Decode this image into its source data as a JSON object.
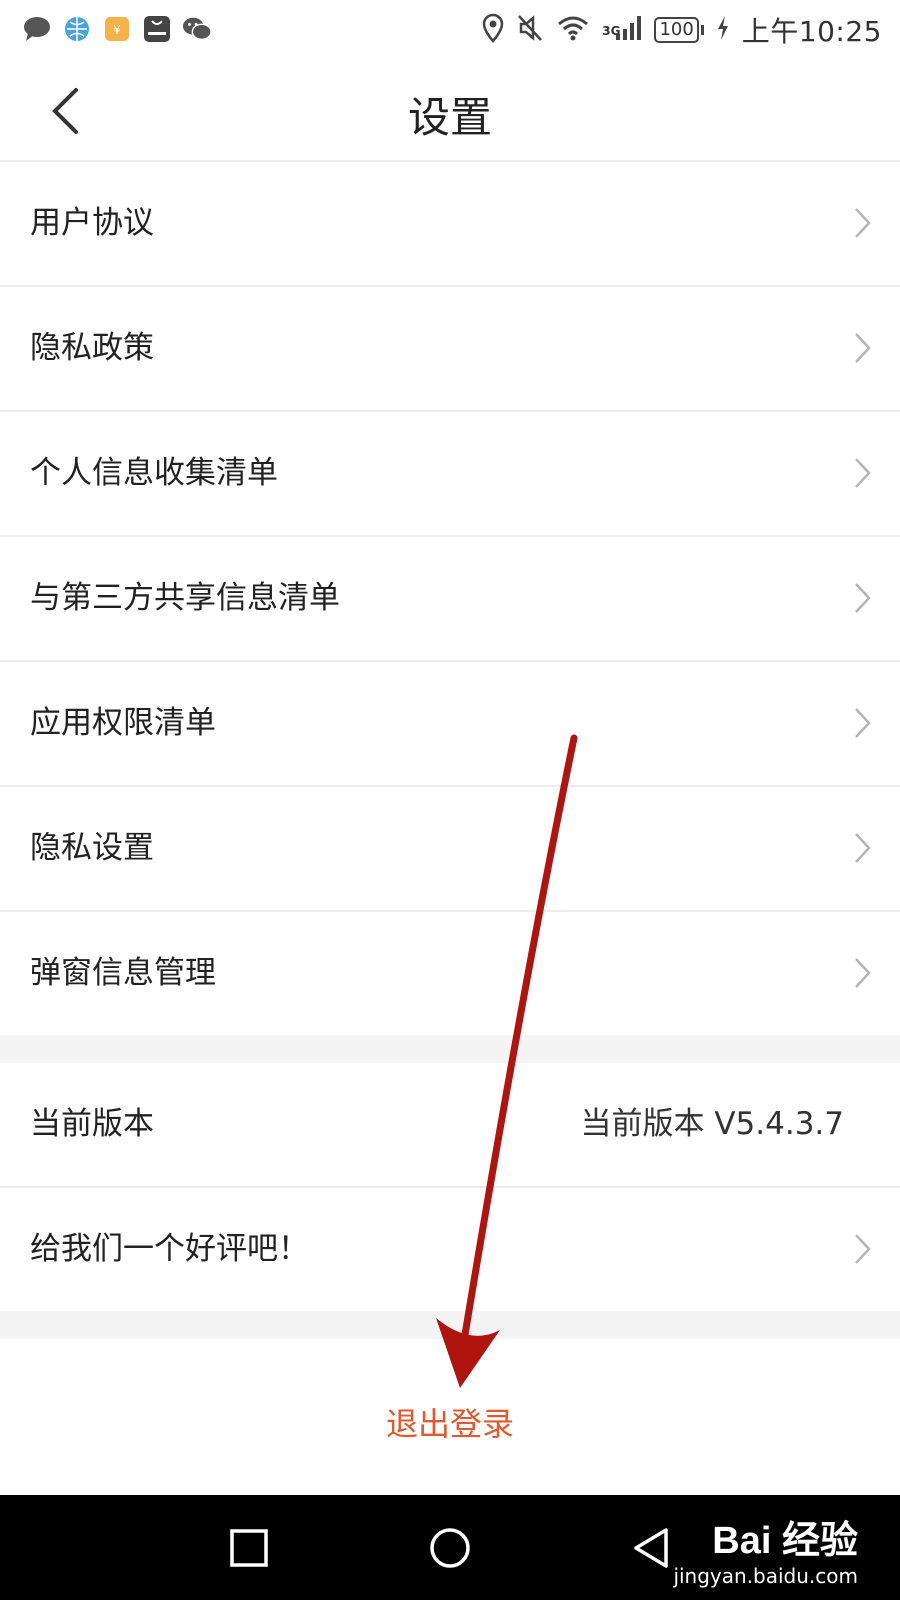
{
  "status_bar": {
    "time": "上午10:25",
    "battery": "100",
    "network": "3G",
    "left_icons": [
      "message-icon",
      "browser-icon",
      "wallet-icon",
      "huawei-icon",
      "wechat-icon"
    ],
    "right_icons": [
      "location-icon",
      "mute-icon",
      "wifi-icon",
      "signal-icon",
      "battery-icon",
      "charging-icon"
    ]
  },
  "header": {
    "title": "设置",
    "back_icon": "chevron-left-icon"
  },
  "settings": {
    "items": [
      {
        "label": "用户协议"
      },
      {
        "label": "隐私政策"
      },
      {
        "label": "个人信息收集清单"
      },
      {
        "label": "与第三方共享信息清单"
      },
      {
        "label": "应用权限清单"
      },
      {
        "label": "隐私设置"
      },
      {
        "label": "弹窗信息管理"
      }
    ],
    "version_label": "当前版本",
    "version_value": "当前版本 V5.4.3.7",
    "rate_label": "给我们一个好评吧！",
    "logout_label": "退出登录"
  },
  "nav_bar": {
    "icons": [
      "square-icon",
      "circle-icon",
      "triangle-back-icon"
    ]
  },
  "watermark": {
    "main": "Bai 经验",
    "sub": "jingyan.baidu.com"
  },
  "colors": {
    "logout": "#e05a2f",
    "annotation_arrow": "#b0140f",
    "divider": "#ededed",
    "gap": "#f4f4f4"
  }
}
